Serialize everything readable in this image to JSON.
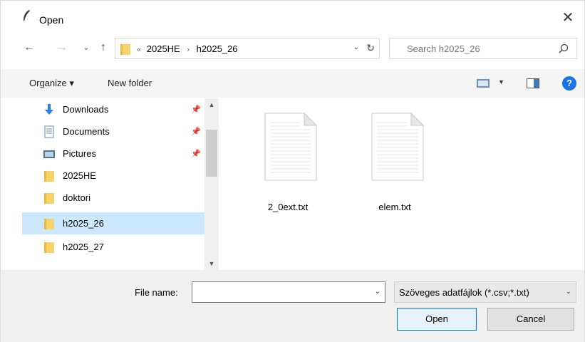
{
  "window": {
    "title": "Open"
  },
  "address": {
    "overflow": "«",
    "crumbs": [
      "2025HE",
      "h2025_26"
    ]
  },
  "search": {
    "placeholder": "Search h2025_26"
  },
  "toolbar": {
    "organize": "Organize ▾",
    "new_folder": "New folder",
    "help": "?"
  },
  "nav_items": [
    {
      "label": "Downloads",
      "icon": "downloads-icon",
      "pinned": true
    },
    {
      "label": "Documents",
      "icon": "documents-icon",
      "pinned": true
    },
    {
      "label": "Pictures",
      "icon": "pictures-icon",
      "pinned": true
    },
    {
      "label": "2025HE",
      "icon": "folder-icon",
      "pinned": false
    },
    {
      "label": "doktori",
      "icon": "folder-icon",
      "pinned": false
    },
    {
      "label": "h2025_26",
      "icon": "folder-icon",
      "pinned": false,
      "selected": true
    },
    {
      "label": "h2025_27",
      "icon": "folder-icon",
      "pinned": false
    }
  ],
  "files": [
    {
      "name": "2_0ext.txt",
      "icon": "text-file-icon"
    },
    {
      "name": "elem.txt",
      "icon": "text-file-icon"
    }
  ],
  "bottom": {
    "file_name_label": "File name:",
    "file_name_value": "",
    "filter": "Szöveges adatfájlok (*.csv;*.txt)",
    "open": "Open",
    "cancel": "Cancel"
  },
  "colors": {
    "selection": "#cce8ff",
    "folder": "#f6d46b",
    "accent": "#0078d7"
  }
}
